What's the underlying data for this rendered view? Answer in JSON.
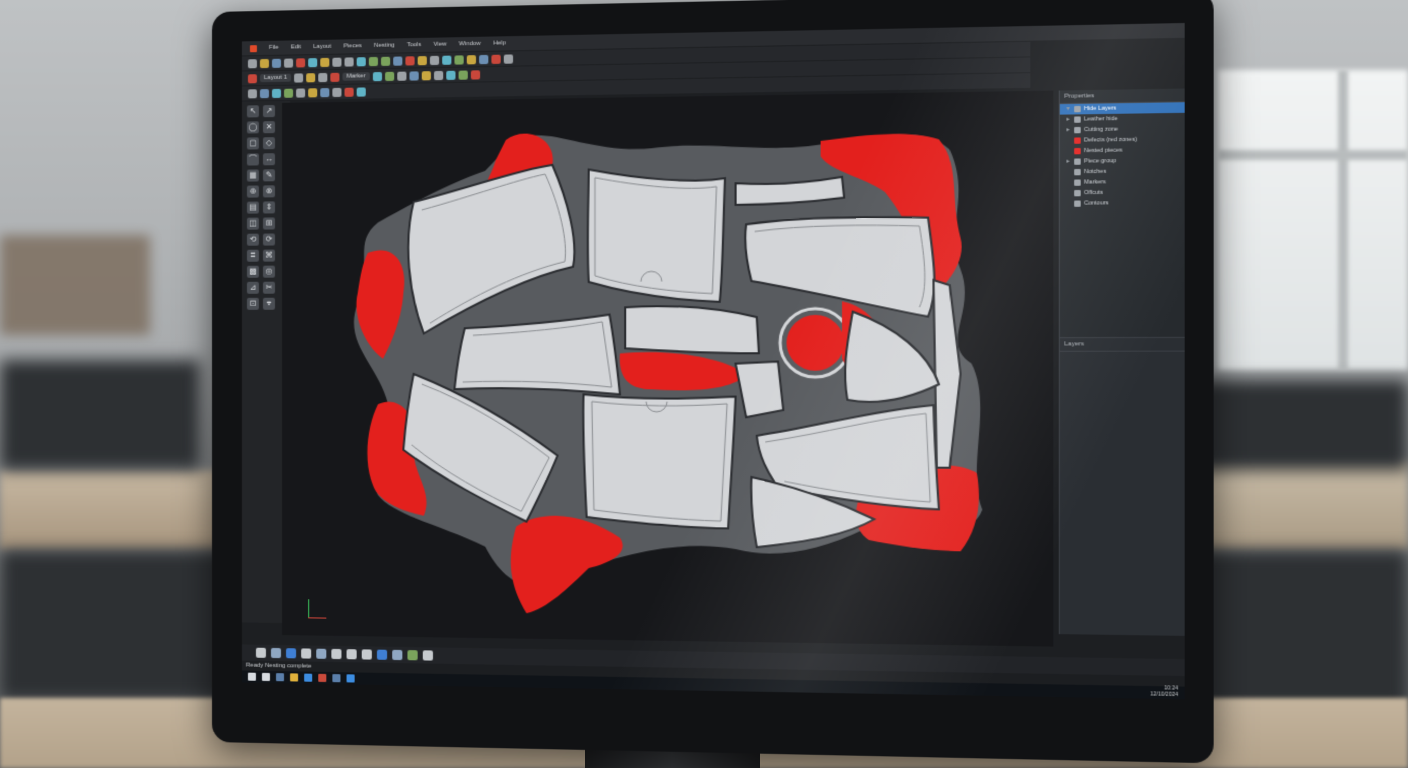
{
  "menu": {
    "items": [
      "File",
      "Edit",
      "Layout",
      "Pieces",
      "Nesting",
      "Tools",
      "View",
      "Window",
      "Help"
    ]
  },
  "toolbar": {
    "field_label": "Layout 1",
    "field2_label": "Marker"
  },
  "left_tools": [
    "↖",
    "↗",
    "◯",
    "✕",
    "▢",
    "◇",
    "⌒",
    "↔",
    "▦",
    "✎",
    "⊕",
    "⊗",
    "▤",
    "⇕",
    "◫",
    "⊞",
    "⟲",
    "⟳",
    "⌗",
    "⌘",
    "▩",
    "◎",
    "⊿",
    "✂",
    "⊡",
    "⌖"
  ],
  "right_panel": {
    "header": "Properties",
    "tree": [
      {
        "label": "Hide Layers",
        "selected": true
      },
      {
        "label": "Leather hide",
        "selected": false
      },
      {
        "label": "Cutting zone",
        "selected": false
      },
      {
        "label": "Defects (red zones)",
        "selected": false
      },
      {
        "label": "Nested pieces",
        "selected": false
      },
      {
        "label": "Piece group",
        "selected": false
      },
      {
        "label": "Notches",
        "selected": false
      },
      {
        "label": "Markers",
        "selected": false
      },
      {
        "label": "Offcuts",
        "selected": false
      },
      {
        "label": "Contours",
        "selected": false
      }
    ],
    "lower_header": "Layers"
  },
  "status": {
    "text": "Ready   Nesting complete"
  },
  "clock": {
    "time": "10:24",
    "date": "12/10/2024"
  },
  "colors": {
    "hide": "#585b5f",
    "defect": "#e3201d",
    "piece_fill": "#d3d5d8",
    "piece_stroke": "#2a2c30",
    "canvas": "#16171a"
  }
}
